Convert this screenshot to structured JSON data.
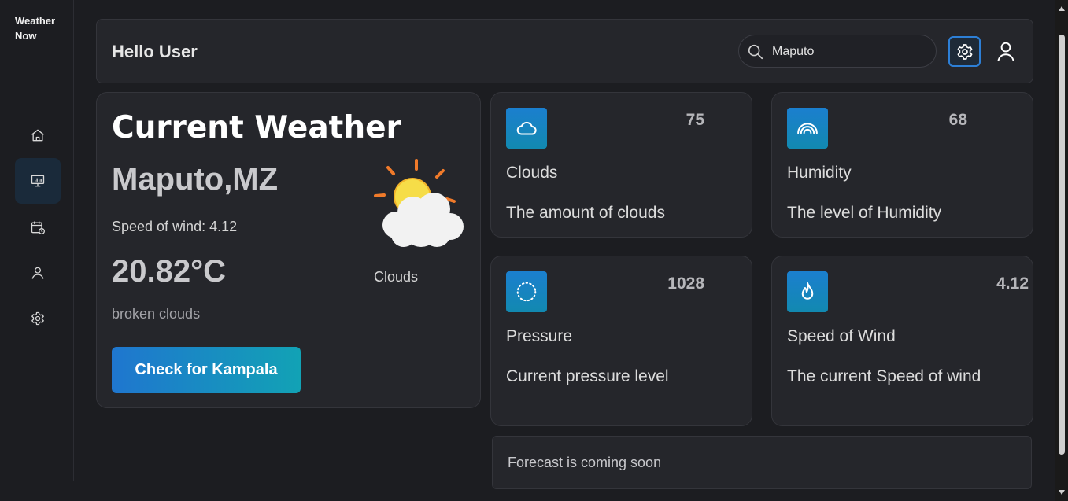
{
  "app": {
    "brand_line1": "Weather",
    "brand_line2": "Now"
  },
  "sidebar": {
    "items": [
      {
        "icon": "home-icon",
        "active": false
      },
      {
        "icon": "dashboard-icon",
        "active": true
      },
      {
        "icon": "calendar-icon",
        "active": false
      },
      {
        "icon": "user-icon",
        "active": false
      },
      {
        "icon": "settings-icon",
        "active": false
      }
    ]
  },
  "header": {
    "greeting": "Hello User",
    "search_value": "Maputo",
    "settings_icon": "gear-icon",
    "profile_icon": "user-icon"
  },
  "current": {
    "title": "Current Weather",
    "city": "Maputo,MZ",
    "wind_line": "Speed of wind: 4.12",
    "temperature": "20.82°C",
    "description": "broken clouds",
    "condition": "Clouds",
    "condition_icon": "sun-behind-cloud-icon",
    "button_label": "Check for Kampala"
  },
  "stats": {
    "clouds": {
      "value": "75",
      "name": "Clouds",
      "sub": "The amount of clouds",
      "icon": "cloud-icon"
    },
    "humidity": {
      "value": "68",
      "name": "Humidity",
      "sub": "The level of Humidity",
      "icon": "rainbow-icon"
    },
    "pressure": {
      "value": "1028",
      "name": "Pressure",
      "sub": "Current pressure level",
      "icon": "dotted-circle-icon"
    },
    "wind": {
      "value": "4.12",
      "name": "Speed of Wind",
      "sub": "The current Speed of wind",
      "icon": "flame-icon"
    }
  },
  "forecast": {
    "text": "Forecast is coming soon"
  },
  "colors": {
    "accent": "#2d7fd6",
    "gradient_start": "#1f76cf",
    "gradient_end": "#12a2b5",
    "card_bg": "#25262b",
    "page_bg": "#1c1d21"
  }
}
